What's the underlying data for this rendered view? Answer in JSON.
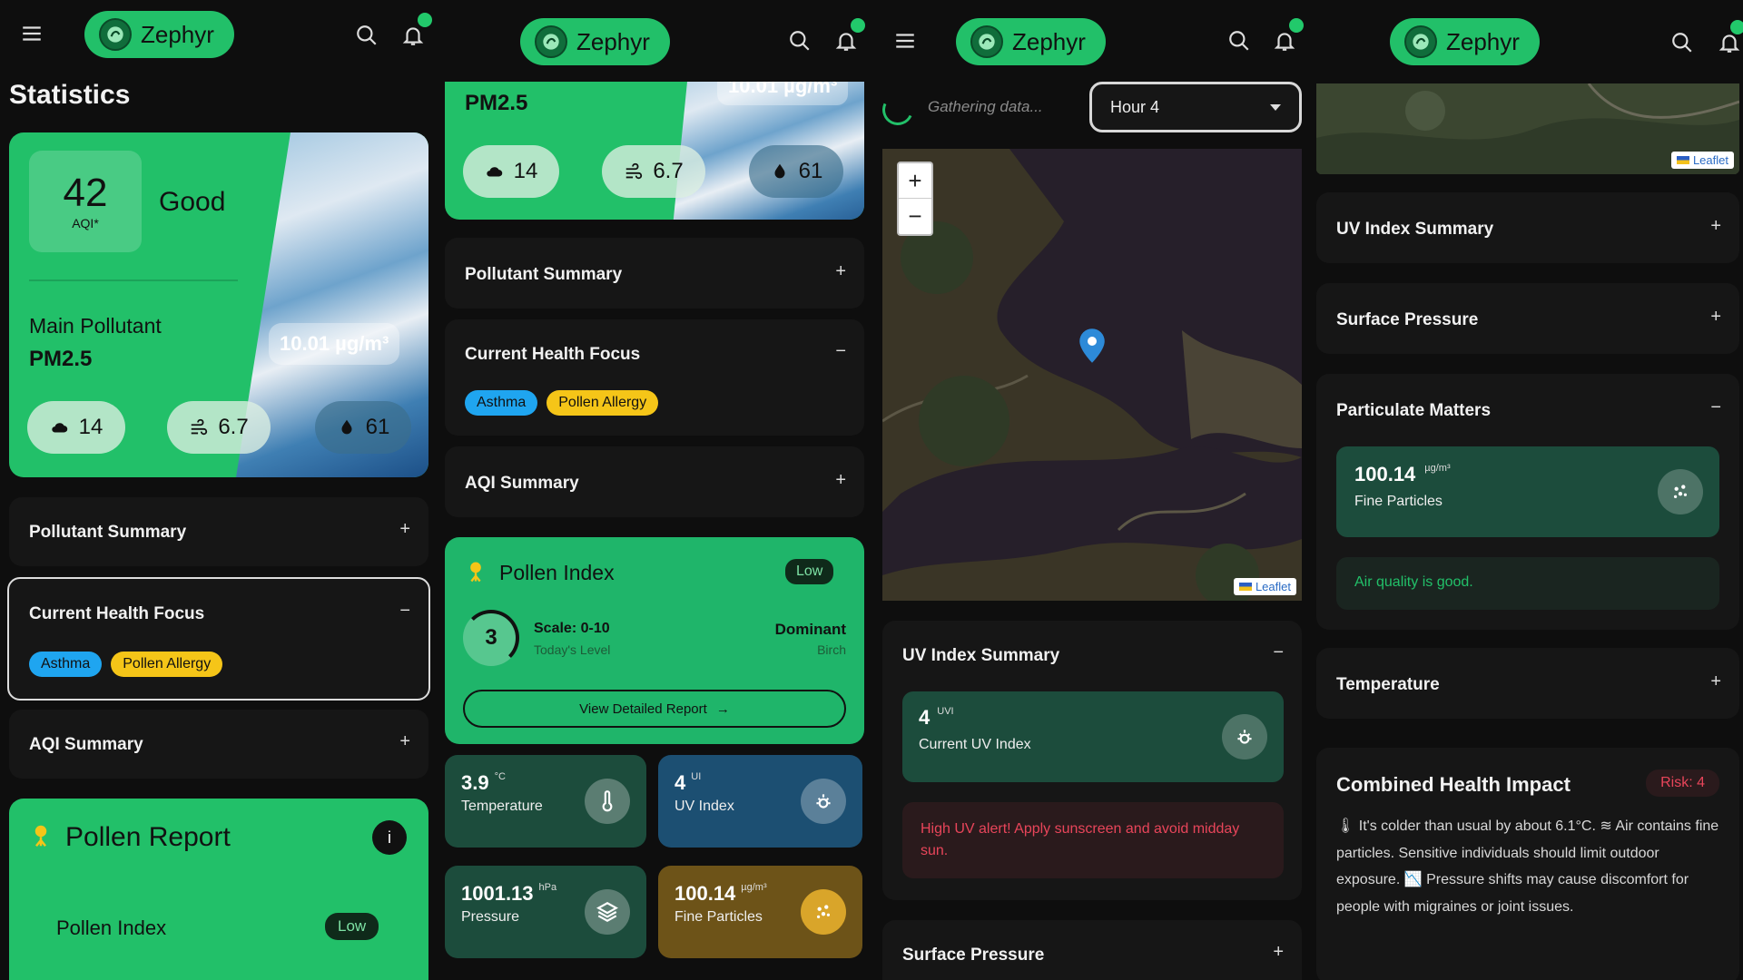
{
  "app": {
    "name": "Zephyr"
  },
  "screen1": {
    "title": "Statistics",
    "aqi": {
      "value": "42",
      "label": "AQI*",
      "status": "Good"
    },
    "main_pollutant": {
      "label": "Main Pollutant",
      "value": "PM2.5",
      "concentration": "10.01 µg/m³"
    },
    "stats": [
      {
        "icon": "cloud-icon",
        "value": "14"
      },
      {
        "icon": "wind-icon",
        "value": "6.7"
      },
      {
        "icon": "drop-icon",
        "value": "61"
      }
    ],
    "pollutant_summary": "Pollutant Summary",
    "health_focus": {
      "title": "Current Health Focus",
      "chips": [
        "Asthma",
        "Pollen Allergy"
      ]
    },
    "aqi_summary": "AQI Summary",
    "pollen_report": {
      "title": "Pollen Report",
      "row_label": "Pollen Index",
      "row_badge": "Low"
    }
  },
  "screen2": {
    "pollutant_label": "PM2.5",
    "concentration": "10.01 µg/m³",
    "stats": [
      {
        "icon": "cloud-icon",
        "value": "14"
      },
      {
        "icon": "wind-icon",
        "value": "6.7"
      },
      {
        "icon": "drop-icon",
        "value": "61"
      }
    ],
    "pollutant_summary": "Pollutant Summary",
    "health_focus": {
      "title": "Current Health Focus",
      "chips": [
        "Asthma",
        "Pollen Allergy"
      ]
    },
    "aqi_summary": "AQI Summary",
    "pollen_index": {
      "title": "Pollen Index",
      "badge": "Low",
      "level": "3",
      "scale": "Scale: 0-10",
      "scale_sub": "Today's Level",
      "dominant": "Dominant",
      "dominant_value": "Birch",
      "button": "View Detailed Report"
    },
    "tiles": [
      {
        "value": "3.9",
        "unit": "°C",
        "label": "Temperature",
        "icon": "thermometer-icon"
      },
      {
        "value": "4",
        "unit": "UI",
        "label": "UV Index",
        "icon": "sun-icon"
      },
      {
        "value": "1001.13",
        "unit": "hPa",
        "label": "Pressure",
        "icon": "layers-icon"
      },
      {
        "value": "100.14",
        "unit": "µg/m³",
        "label": "Fine Particles",
        "icon": "particles-icon"
      }
    ]
  },
  "screen3": {
    "gathering": "Gathering data...",
    "select_value": "Hour 4",
    "zoom_in": "+",
    "zoom_out": "−",
    "leaflet": "Leaflet",
    "uv_summary": {
      "title": "UV Index Summary",
      "value": "4",
      "unit": "UVI",
      "label": "Current UV Index",
      "alert": "High UV alert! Apply sunscreen and avoid midday sun."
    },
    "surface_pressure": "Surface Pressure"
  },
  "screen4": {
    "leaflet": "Leaflet",
    "uv_summary": "UV Index Summary",
    "surface_pressure": "Surface Pressure",
    "particulate": {
      "title": "Particulate Matters",
      "value": "100.14",
      "unit": "µg/m³",
      "label": "Fine Particles",
      "message": "Air quality is good."
    },
    "temperature": "Temperature",
    "combined": {
      "title": "Combined Health Impact",
      "risk": "Risk: 4",
      "text": "🌡 It's colder than usual by about 6.1°C. ≋ Air contains fine particles. Sensitive individuals should limit outdoor exposure. 📉 Pressure shifts may cause discomfort for people with migraines or joint issues."
    }
  },
  "colors": {
    "accent": "#22c069",
    "chip_blue": "#1fa5f0",
    "chip_yellow": "#f5c518",
    "alert": "#e8455a"
  }
}
